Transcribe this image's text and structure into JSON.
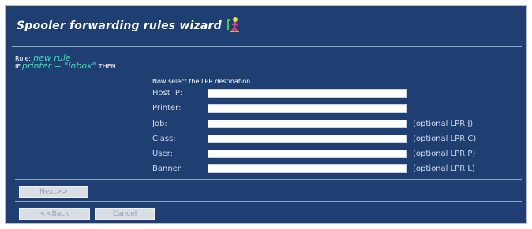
{
  "wizard": {
    "title": "Spooler forwarding rules wizard",
    "logo_icon": "jumping-figure-logo"
  },
  "rule": {
    "label": "Rule:",
    "name": "new rule",
    "condition_prefix": "IF",
    "condition": "printer = \"inbox\"",
    "condition_suffix": "THEN"
  },
  "form": {
    "instruction": "Now select the LPR destination ...",
    "fields": [
      {
        "label": "Host IP:",
        "value": "",
        "hint": ""
      },
      {
        "label": "Printer:",
        "value": "",
        "hint": ""
      },
      {
        "label": "Job:",
        "value": "",
        "hint": "(optional LPR J)"
      },
      {
        "label": "Class:",
        "value": "",
        "hint": "(optional LPR C)"
      },
      {
        "label": "User:",
        "value": "",
        "hint": "(optional LPR P)"
      },
      {
        "label": "Banner:",
        "value": "",
        "hint": "(optional LPR L)"
      }
    ]
  },
  "buttons": {
    "next": "Next>>",
    "back": "<<Back",
    "cancel": "Cancel"
  },
  "colors": {
    "panel_bg": "#1f3f73",
    "accent": "#36e0b6"
  }
}
